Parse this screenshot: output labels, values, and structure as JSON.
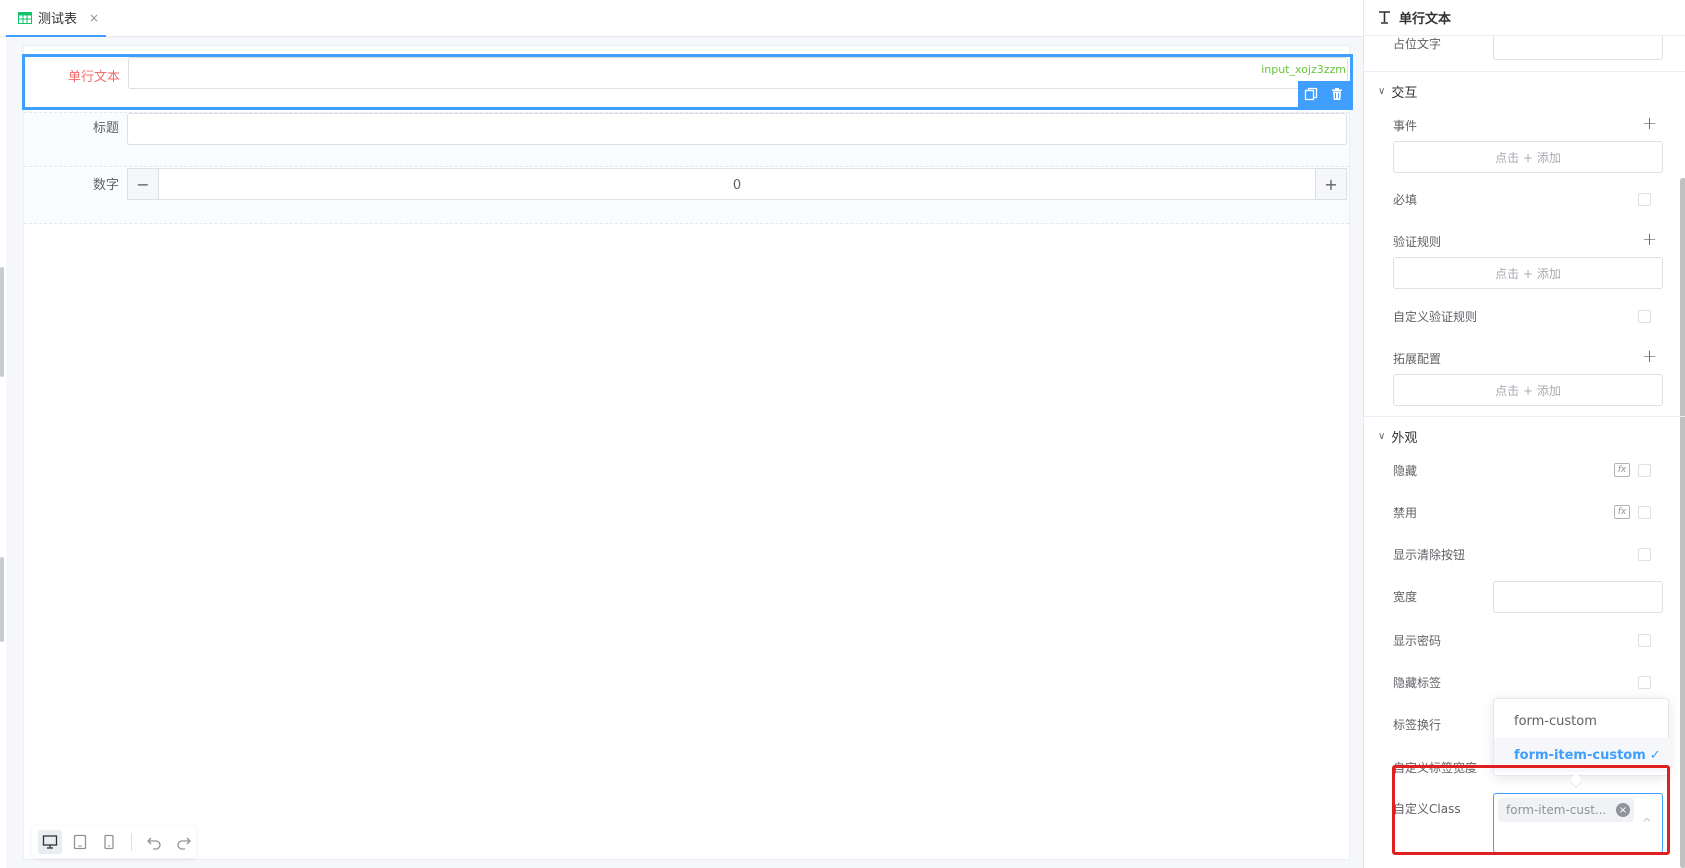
{
  "tab": {
    "label": "测试表",
    "close": "×"
  },
  "form": {
    "field1": {
      "label": "单行文本",
      "field_id": "input_xojz3zzm"
    },
    "field2": {
      "label": "标题"
    },
    "field3": {
      "label": "数字",
      "value": "0",
      "minus": "−",
      "plus": "+"
    }
  },
  "panel": {
    "title": "单行文本",
    "placeholder_label": "占位文字",
    "section_interaction": "交互",
    "event_label": "事件",
    "add_text": "点击 + 添加",
    "required_label": "必填",
    "validation_label": "验证规则",
    "custom_validation_label": "自定义验证规则",
    "ext_config_label": "拓展配置",
    "section_appearance": "外观",
    "hidden_label": "隐藏",
    "disabled_label": "禁用",
    "show_clear_label": "显示清除按钮",
    "width_label": "宽度",
    "show_password_label": "显示密码",
    "hide_label_label": "隐藏标签",
    "label_wrap_label": "标签换行",
    "custom_label_width_label": "自定义标签宽度",
    "custom_class_label": "自定义Class",
    "fx": "fx",
    "plus": "+"
  },
  "dropdown": {
    "options": [
      "form-custom",
      "form-item-custom"
    ],
    "selected": "form-item-custom",
    "check": "✓"
  },
  "multiselect": {
    "tag": "form-item-cust...",
    "caret": "^"
  },
  "colors": {
    "accent": "#409eff",
    "field_id": "#67c23a",
    "required_label": "#f56c6c",
    "annotation": "#e02020"
  }
}
